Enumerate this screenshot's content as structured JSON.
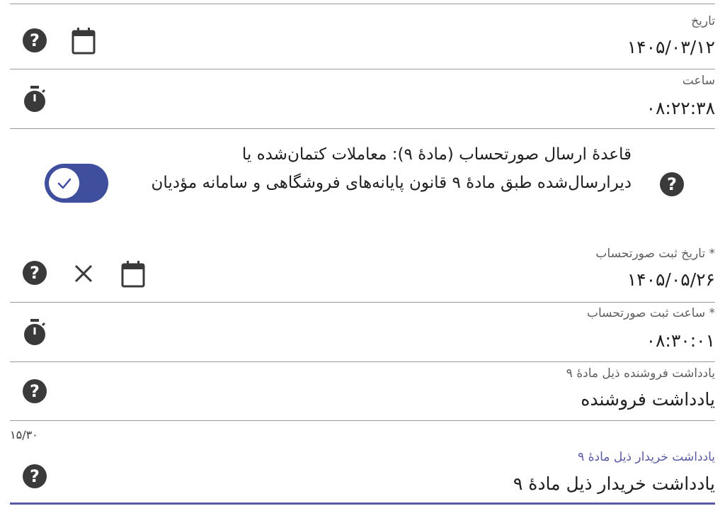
{
  "date_field": {
    "label": "تاریخ",
    "value": "۱۴۰۵/۰۳/۱۲"
  },
  "time_field": {
    "label": "ساعت",
    "value": "۰۸:۲۲:۳۸"
  },
  "rule_toggle": {
    "text": "قاعدهٔ ارسال صورتحساب (مادهٔ ۹): معاملات کتمان‌شده یا دیرارسال‌شده طبق مادهٔ ۹ قانون پایانه‌های فروشگاهی و سامانه مؤدیان",
    "checked": true
  },
  "invoice_date_field": {
    "label": "* تاریخ ثبت صورتحساب",
    "value": "۱۴۰۵/۰۵/۲۶"
  },
  "invoice_time_field": {
    "label": "* ساعت ثبت صورتحساب",
    "value": "۰۸:۳۰:۰۱"
  },
  "seller_note_field": {
    "label": "یادداشت فروشنده ذیل مادهٔ ۹",
    "value": "یادداشت فروشنده",
    "counter": "۱۵/۳۰"
  },
  "buyer_note_field": {
    "label": "یادداشت خریدار ذیل مادهٔ ۹",
    "value": "یادداشت خریدار ذیل مادهٔ ۹"
  },
  "colors": {
    "accent": "#5a5aa6",
    "toggle_track": "#3f4f9e",
    "icon": "#3a3a3a"
  }
}
